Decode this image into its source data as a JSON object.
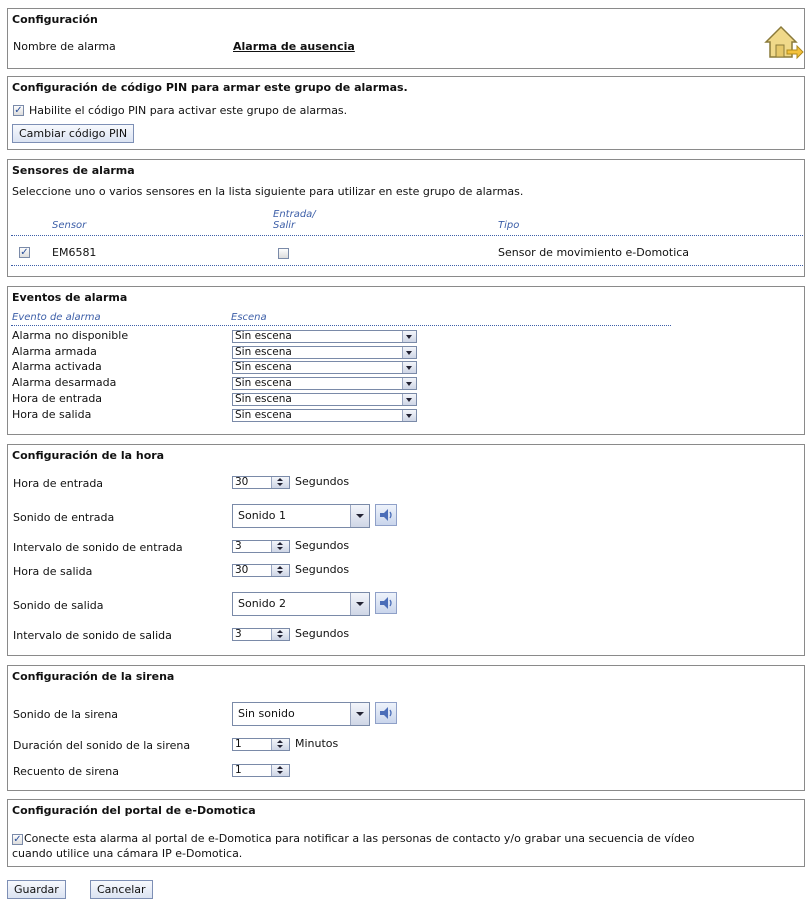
{
  "config": {
    "title": "Configuración",
    "alarm_name_label": "Nombre de alarma",
    "alarm_name_value": "Alarma de ausencia",
    "home_icon": "home-exit-icon"
  },
  "pin": {
    "title": "Configuración de código PIN para armar este grupo de alarmas.",
    "enable_label": "Habilite el código PIN para activar este grupo de alarmas.",
    "enable_checked": true,
    "change_button": "Cambiar código PIN"
  },
  "sensors": {
    "title": "Sensores de alarma",
    "description": "Seleccione uno o varios sensores en la lista siguiente para utilizar en este grupo de alarmas.",
    "col_sensor": "Sensor",
    "col_entry_line1": "Entrada/",
    "col_entry_line2": "Salir",
    "col_type": "Tipo",
    "rows": [
      {
        "checked": true,
        "name": "EM6581",
        "entry_exit": false,
        "type": "Sensor de movimiento e-Domotica"
      }
    ]
  },
  "events": {
    "title": "Eventos de alarma",
    "col_event": "Evento de alarma",
    "col_scene": "Escena",
    "rows": [
      {
        "label": "Alarma no disponible",
        "scene": "Sin escena"
      },
      {
        "label": "Alarma armada",
        "scene": "Sin escena"
      },
      {
        "label": "Alarma activada",
        "scene": "Sin escena"
      },
      {
        "label": "Alarma desarmada",
        "scene": "Sin escena"
      },
      {
        "label": "Hora de entrada",
        "scene": "Sin escena"
      },
      {
        "label": "Hora de salida",
        "scene": "Sin escena"
      }
    ]
  },
  "time": {
    "title": "Configuración de la hora",
    "entry_time_label": "Hora de entrada",
    "entry_time_value": "30",
    "entry_time_unit": "Segundos",
    "entry_sound_label": "Sonido de entrada",
    "entry_sound_value": "Sonido 1",
    "entry_interval_label": "Intervalo de sonido de entrada",
    "entry_interval_value": "3",
    "entry_interval_unit": "Segundos",
    "exit_time_label": "Hora de salida",
    "exit_time_value": "30",
    "exit_time_unit": "Segundos",
    "exit_sound_label": "Sonido de salida",
    "exit_sound_value": "Sonido 2",
    "exit_interval_label": "Intervalo de sonido de salida",
    "exit_interval_value": "3",
    "exit_interval_unit": "Segundos"
  },
  "siren": {
    "title": "Configuración de la sirena",
    "sound_label": "Sonido de la sirena",
    "sound_value": "Sin sonido",
    "duration_label": "Duración del sonido de la sirena",
    "duration_value": "1",
    "duration_unit": "Minutos",
    "count_label": "Recuento de sirena",
    "count_value": "1"
  },
  "portal": {
    "title": "Configuración del portal de e-Domotica",
    "connect_line1": "Conecte esta alarma al portal de e-Domotica para notificar a las personas de contacto y/o grabar una secuencia de vídeo",
    "connect_line2": "cuando utilice una cámara IP e-Domotica.",
    "connect_checked": true
  },
  "footer": {
    "save": "Guardar",
    "cancel": "Cancelar"
  }
}
